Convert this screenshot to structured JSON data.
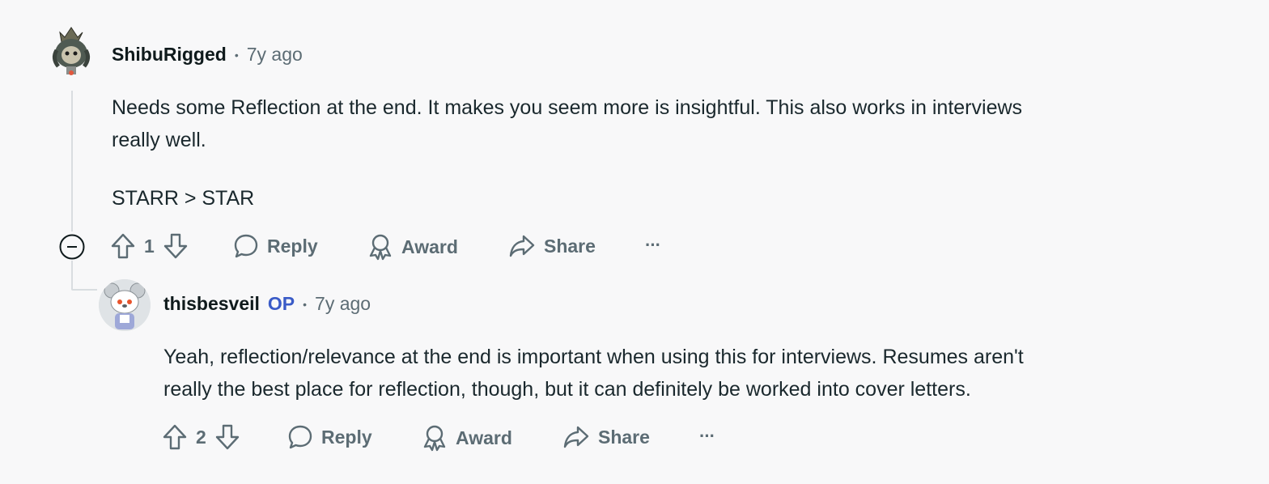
{
  "comments": [
    {
      "username": "ShibuRigged",
      "time": "7y ago",
      "body": [
        "Needs some Reflection at the end. It makes you seem more is insightful. This also works in interviews",
        "really well.",
        "STARR > STAR"
      ],
      "votes": "1",
      "actions": {
        "reply": "Reply",
        "award": "Award",
        "share": "Share",
        "more": "···"
      }
    },
    {
      "username": "thisbesveil",
      "flair": "OP",
      "time": "7y ago",
      "body": [
        "Yeah, reflection/relevance at the end is important when using this for interviews. Resumes aren't",
        "really the best place for reflection, though, but it can definitely be worked into cover letters."
      ],
      "votes": "2",
      "actions": {
        "reply": "Reply",
        "award": "Award",
        "share": "Share",
        "more": "···"
      }
    }
  ],
  "icons": {
    "upvote": "arrow-up-icon",
    "downvote": "arrow-down-icon",
    "reply": "speech-bubble-icon",
    "award": "award-ribbon-icon",
    "share": "share-arrow-icon",
    "collapse": "minus-circle-icon"
  },
  "colors": {
    "background": "#f8f8f9",
    "text": "#1a282d",
    "muted": "#5c6c74",
    "op": "#3a5bc7"
  }
}
